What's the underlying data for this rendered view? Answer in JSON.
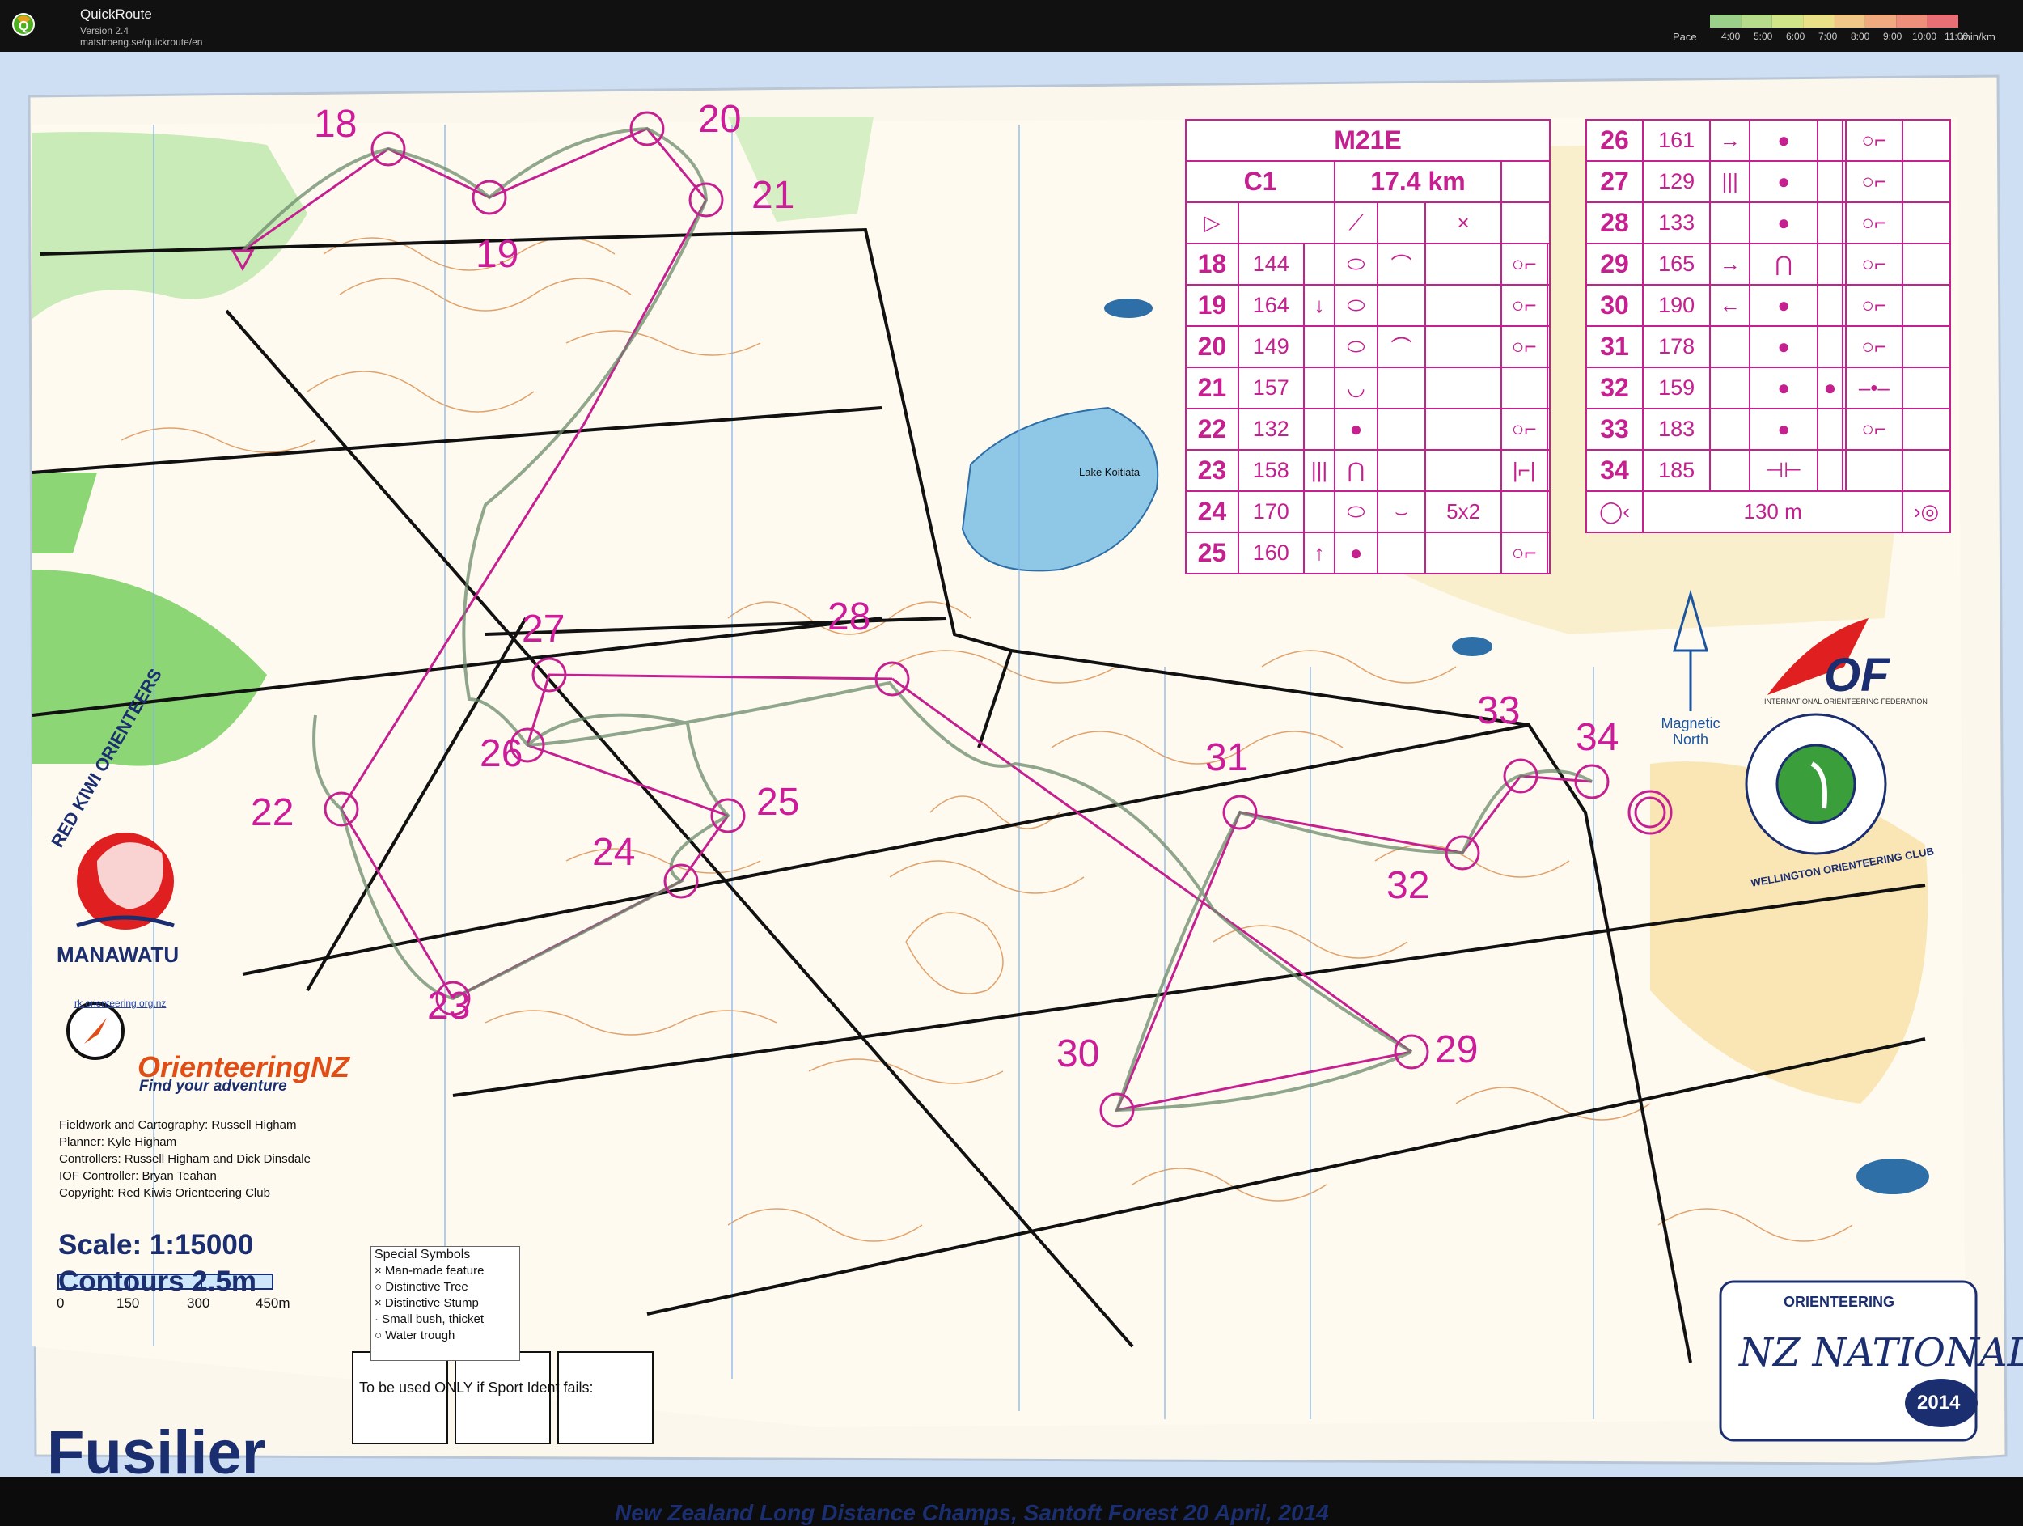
{
  "window": {
    "app_name": "QuickRoute",
    "version": "Version 2.4",
    "url": "matstroeng.se/quickroute/en",
    "pace_label": "Pace",
    "pace_ticks": [
      "4:00",
      "5:00",
      "6:00",
      "7:00",
      "8:00",
      "9:00",
      "10:00",
      "11:00"
    ],
    "pace_unit": "min/km",
    "pace_colors": [
      "#9bd08a",
      "#b6db8a",
      "#d2e488",
      "#e9e088",
      "#f1c788",
      "#f0aa80",
      "#ee8f7c",
      "#e86f76"
    ]
  },
  "map": {
    "event_name": "Fusilier",
    "footer": "New Zealand Long Distance Champs, Santoft Forest   20 April, 2014",
    "scale": "Scale: 1:15000",
    "contours": "Contours  2.5m",
    "scale_bar_labels": [
      "0",
      "150",
      "300",
      "450m"
    ],
    "credits": [
      "Fieldwork and Cartography: Russell Higham",
      "Planner: Kyle Higham",
      "Controllers: Russell Higham and Dick Dinsdale",
      "IOF Controller: Bryan Teahan",
      "Copyright: Red Kiwis Orienteering Club"
    ],
    "special_symbols": {
      "title": "Special Symbols",
      "items": [
        "× Man-made feature",
        "○ Distinctive Tree",
        "× Distinctive Stump",
        "· Small bush, thicket",
        "○ Water trough"
      ]
    },
    "sport_ident_note": "To be used ONLY if Sport Ident fails:",
    "lake_label": "Lake Koitiata",
    "magnetic_north": "Magnetic North",
    "clubs": {
      "red_kiwi": "RED KIWI ORIENTEERS",
      "manawatu": "MANAWATU",
      "manawatu_url": "rk.orienteering.org.nz",
      "onz": "OrienteeringNZ",
      "onz_tagline": "Find your adventure",
      "iof": "IOF",
      "iof_full": "INTERNATIONAL ORIENTEERING FEDERATION",
      "wellington": "WELLINGTON ORIENTEERING CLUB",
      "nationals": "NZ NATIONALS",
      "nationals_top": "ORIENTEERING",
      "nationals_year": "2014"
    },
    "control_numbers": [
      "18",
      "19",
      "20",
      "21",
      "22",
      "23",
      "24",
      "25",
      "26",
      "27",
      "28",
      "29",
      "30",
      "31",
      "32",
      "33",
      "34"
    ]
  },
  "description_sheet": {
    "class": "M21E",
    "course": "C1",
    "length": "17.4 km",
    "start_row": [
      "▷",
      "",
      "⟋",
      "",
      "×",
      ""
    ],
    "left_rows": [
      {
        "num": "18",
        "code": "144",
        "dir": "",
        "feat": "⬭",
        "dim": "⌒",
        "extra": "",
        "detail": "○⌐"
      },
      {
        "num": "19",
        "code": "164",
        "dir": "↓",
        "feat": "⬭",
        "dim": "",
        "extra": "",
        "detail": "○⌐"
      },
      {
        "num": "20",
        "code": "149",
        "dir": "",
        "feat": "⬭",
        "dim": "⌒",
        "extra": "",
        "detail": "○⌐"
      },
      {
        "num": "21",
        "code": "157",
        "dir": "",
        "feat": "◡",
        "dim": "",
        "extra": "",
        "detail": ""
      },
      {
        "num": "22",
        "code": "132",
        "dir": "",
        "feat": "●",
        "dim": "",
        "extra": "",
        "detail": "○⌐"
      },
      {
        "num": "23",
        "code": "158",
        "dir": "|||",
        "feat": "⋂",
        "dim": "",
        "extra": "",
        "detail": "|⌐|"
      },
      {
        "num": "24",
        "code": "170",
        "dir": "",
        "feat": "⬭",
        "dim": "⌣",
        "extra": "5x2",
        "detail": ""
      },
      {
        "num": "25",
        "code": "160",
        "dir": "↑",
        "feat": "●",
        "dim": "",
        "extra": "",
        "detail": "○⌐"
      }
    ],
    "right_rows": [
      {
        "num": "26",
        "code": "161",
        "dir": "→",
        "feat": "●",
        "dim": "",
        "extra": "",
        "detail": "○⌐"
      },
      {
        "num": "27",
        "code": "129",
        "dir": "|||",
        "feat": "●",
        "dim": "",
        "extra": "",
        "detail": "○⌐"
      },
      {
        "num": "28",
        "code": "133",
        "dir": "",
        "feat": "●",
        "dim": "",
        "extra": "",
        "detail": "○⌐"
      },
      {
        "num": "29",
        "code": "165",
        "dir": "→",
        "feat": "⋂",
        "dim": "",
        "extra": "",
        "detail": "○⌐"
      },
      {
        "num": "30",
        "code": "190",
        "dir": "←",
        "feat": "●",
        "dim": "",
        "extra": "",
        "detail": "○⌐"
      },
      {
        "num": "31",
        "code": "178",
        "dir": "",
        "feat": "●",
        "dim": "",
        "extra": "",
        "detail": "○⌐"
      },
      {
        "num": "32",
        "code": "159",
        "dir": "",
        "feat": "●",
        "dim": "●",
        "extra": "",
        "detail": "–•–"
      },
      {
        "num": "33",
        "code": "183",
        "dir": "",
        "feat": "●",
        "dim": "",
        "extra": "",
        "detail": "○⌐"
      },
      {
        "num": "34",
        "code": "185",
        "dir": "",
        "feat": "⊣⊢",
        "dim": "",
        "extra": "",
        "detail": ""
      }
    ],
    "finish_distance": "130 m"
  }
}
